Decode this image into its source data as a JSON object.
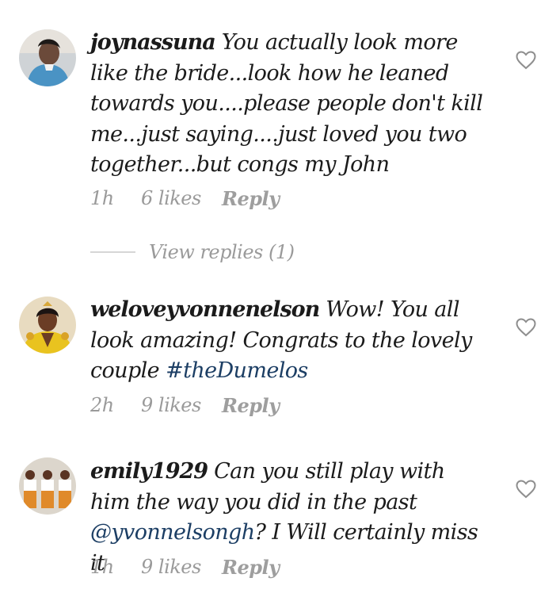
{
  "comments": [
    {
      "username": "joynassuna",
      "text": "You actually look more like the bride...look how he leaned towards you....please people don't kill me...just saying....just loved you two together...but congs my John",
      "time": "1h",
      "likes": "6 likes",
      "reply": "Reply",
      "view_replies": "View replies (1)"
    },
    {
      "username": "weloveyvonnenelson",
      "text_before": "Wow! You all look amazing! Congrats to the lovely couple",
      "hashtag": "#theDumelos",
      "time": "2h",
      "likes": "9 likes",
      "reply": "Reply"
    },
    {
      "username": "emily1929",
      "text_before": "Can you still play with him the way you did in the past",
      "mention": "@yvonnelsongh",
      "text_after": "? I Will certainly miss it",
      "time": "1h",
      "likes": "9 likes",
      "reply": "Reply"
    }
  ],
  "colors": {
    "link": "#1c3e64",
    "meta": "#9a9a9a",
    "heart": "#8e8e8e"
  }
}
